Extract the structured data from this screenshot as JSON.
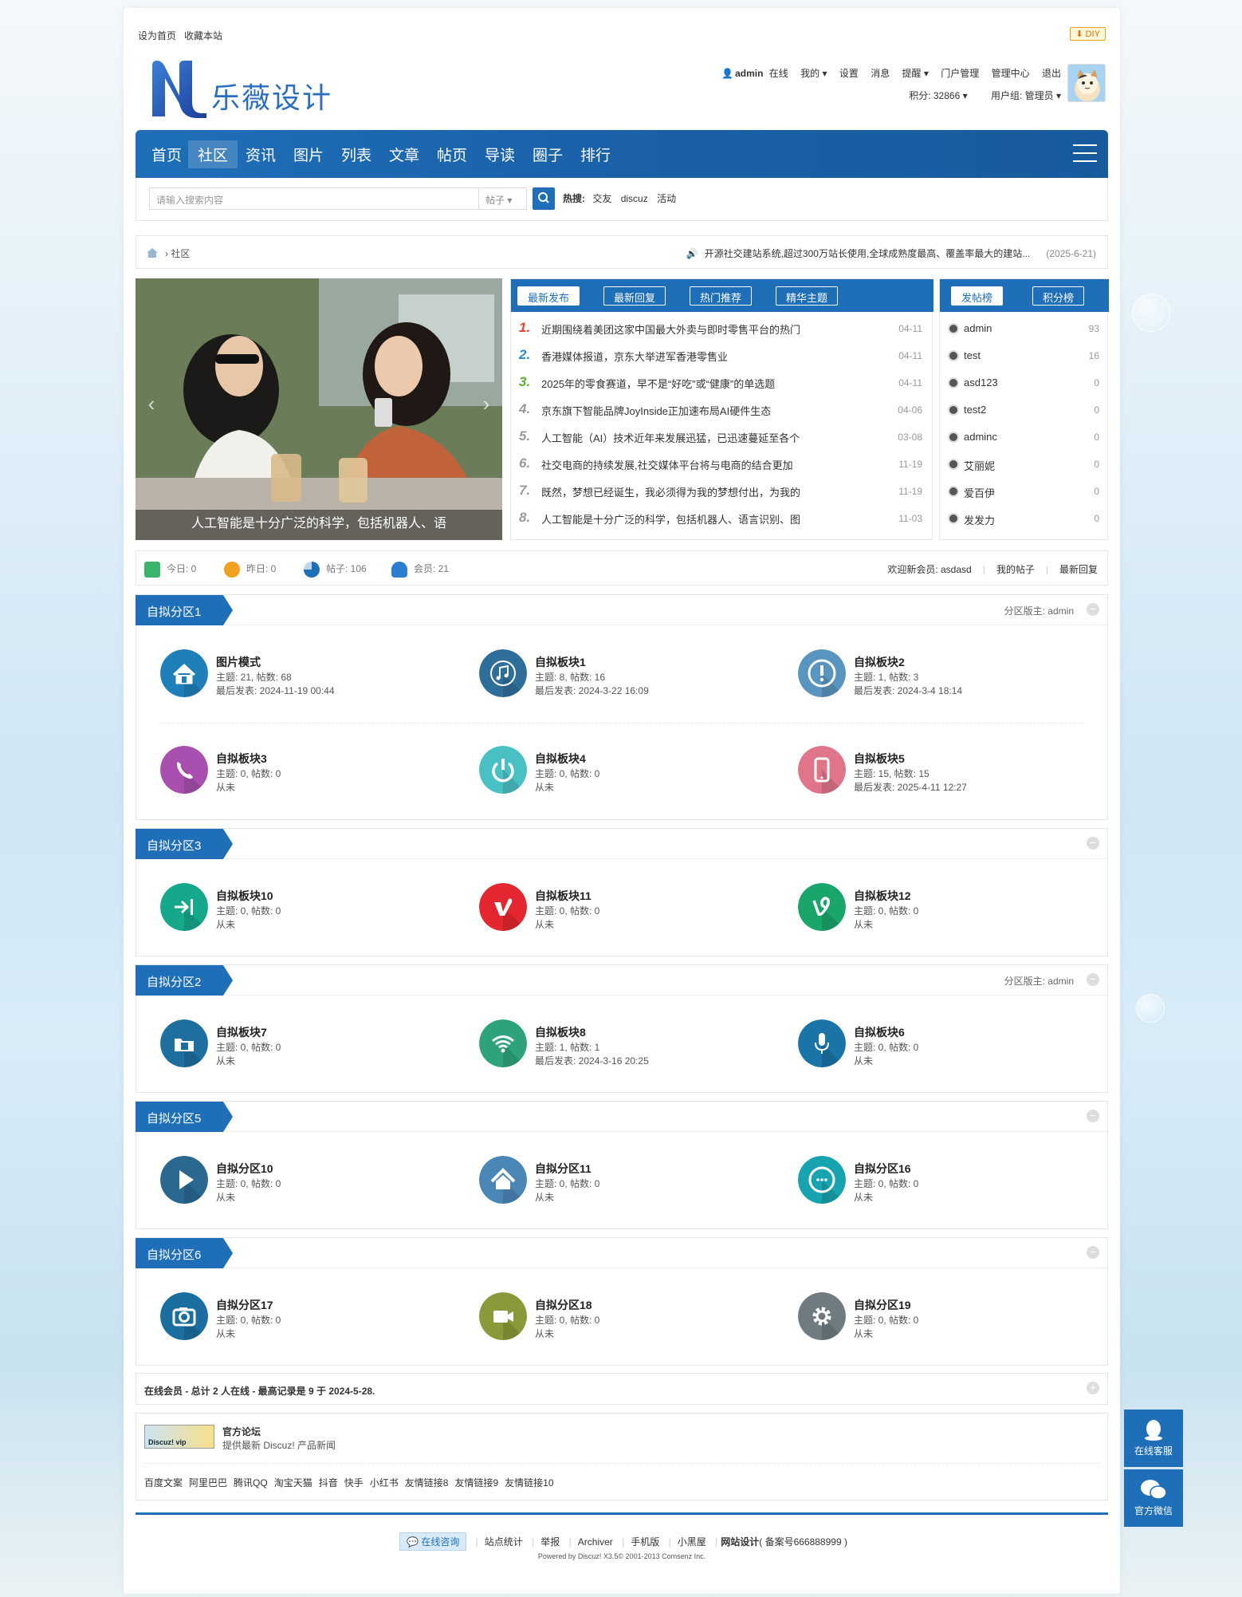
{
  "top": {
    "set_home": "设为首页",
    "bookmark": "收藏本站",
    "diy": "DIY"
  },
  "logo": {
    "text": "乐薇设计"
  },
  "user": {
    "name": "admin",
    "status": "在线",
    "my": "我的",
    "settings": "设置",
    "messages": "消息",
    "remind": "提醒",
    "portal": "门户管理",
    "admin_center": "管理中心",
    "logout": "退出",
    "points": "积分: 32866",
    "group": "用户组: 管理员"
  },
  "nav": {
    "items": [
      "首页",
      "社区",
      "资讯",
      "图片",
      "列表",
      "文章",
      "帖页",
      "导读",
      "圈子",
      "排行"
    ],
    "active": "社区"
  },
  "search": {
    "placeholder": "请输入搜索内容",
    "type": "帖子",
    "hot_label": "热搜:",
    "hot": [
      "交友",
      "discuz",
      "活动"
    ]
  },
  "breadcrumb": {
    "current": "社区"
  },
  "notice": {
    "text": "开源社交建站系统,超过300万站长使用,全球成熟度最高、覆盖率最大的建站...",
    "date": "(2025-6-21)"
  },
  "slide": {
    "caption": "人工智能是十分广泛的科学，包括机器人、语"
  },
  "tabs": [
    "最新发布",
    "最新回复",
    "热门推荐",
    "精华主题"
  ],
  "threads": [
    {
      "n": "1.",
      "t": "近期围绕着美团这家中国最大外卖与即时零售平台的热门",
      "d": "04-11"
    },
    {
      "n": "2.",
      "t": "香港媒体报道，京东大举进军香港零售业",
      "d": "04-11"
    },
    {
      "n": "3.",
      "t": "2025年的零食赛道，早不是“好吃”或“健康”的单选题",
      "d": "04-11"
    },
    {
      "n": "4.",
      "t": "京东旗下智能品牌JoyInside正加速布局AI硬件生态",
      "d": "04-06"
    },
    {
      "n": "5.",
      "t": "人工智能（AI）技术近年来发展迅猛，已迅速蔓延至各个",
      "d": "03-08"
    },
    {
      "n": "6.",
      "t": "社交电商的持续发展,社交媒体平台将与电商的结合更加",
      "d": "11-19"
    },
    {
      "n": "7.",
      "t": "既然，梦想已经诞生，我必须得为我的梦想付出，为我的",
      "d": "11-19"
    },
    {
      "n": "8.",
      "t": "人工智能是十分广泛的科学，包括机器人、语言识别、图",
      "d": "11-03"
    }
  ],
  "rank_tabs": [
    "发帖榜",
    "积分榜"
  ],
  "ranks": [
    {
      "name": "admin",
      "v": "93"
    },
    {
      "name": "test",
      "v": "16"
    },
    {
      "name": "asd123",
      "v": "0"
    },
    {
      "name": "test2",
      "v": "0"
    },
    {
      "name": "adminc",
      "v": "0"
    },
    {
      "name": "艾丽妮",
      "v": "0"
    },
    {
      "name": "爱百伊",
      "v": "0"
    },
    {
      "name": "发发力",
      "v": "0"
    }
  ],
  "stats": {
    "today": "今日: 0",
    "yesterday": "昨日: 0",
    "posts": "帖子: 106",
    "members": "会员: 21",
    "welcome": "欢迎新会员: asdasd",
    "my_posts": "我的帖子",
    "latest_reply": "最新回复"
  },
  "sections": [
    {
      "title": "自拟分区1",
      "mod": "分区版主: admin",
      "forums": [
        {
          "name": "图片模式",
          "s1": "主题: 21, 帖数: 68",
          "s2": "最后发表: 2024-11-19 00:44",
          "icon": "home-icon",
          "color": "#1f7fb8"
        },
        {
          "name": "自拟板块1",
          "s1": "主题: 8, 帖数: 16",
          "s2": "最后发表: 2024-3-22 16:09",
          "icon": "music-icon",
          "color": "#2f6e98"
        },
        {
          "name": "自拟板块2",
          "s1": "主题: 1, 帖数: 3",
          "s2": "最后发表: 2024-3-4 18:14",
          "icon": "alert-icon",
          "color": "#5a95bf"
        },
        {
          "name": "自拟板块3",
          "s1": "主题: 0, 帖数: 0",
          "s2": "从未",
          "icon": "phone-icon",
          "color": "#a94fb0"
        },
        {
          "name": "自拟板块4",
          "s1": "主题: 0, 帖数: 0",
          "s2": "从未",
          "icon": "power-icon",
          "color": "#49c0c4"
        },
        {
          "name": "自拟板块5",
          "s1": "主题: 15, 帖数: 15",
          "s2": "最后发表: 2025-4-11 12:27",
          "icon": "mobile-icon",
          "color": "#e0758a"
        }
      ]
    },
    {
      "title": "自拟分区3",
      "mod": "",
      "forums": [
        {
          "name": "自拟板块10",
          "s1": "主题: 0, 帖数: 0",
          "s2": "从未",
          "icon": "login-icon",
          "color": "#16a88a"
        },
        {
          "name": "自拟板块11",
          "s1": "主题: 0, 帖数: 0",
          "s2": "从未",
          "icon": "vimeo-icon",
          "color": "#e3262f"
        },
        {
          "name": "自拟板块12",
          "s1": "主题: 0, 帖数: 0",
          "s2": "从未",
          "icon": "vine-icon",
          "color": "#1aa56a"
        }
      ]
    },
    {
      "title": "自拟分区2",
      "mod": "分区版主: admin",
      "forums": [
        {
          "name": "自拟板块7",
          "s1": "主题: 0, 帖数: 0",
          "s2": "从未",
          "icon": "folder-icon",
          "color": "#1e6ea0"
        },
        {
          "name": "自拟板块8",
          "s1": "主题: 1, 帖数: 1",
          "s2": "最后发表: 2024-3-16 20:25",
          "icon": "wifi-icon",
          "color": "#2ea37a"
        },
        {
          "name": "自拟板块6",
          "s1": "主题: 0, 帖数: 0",
          "s2": "从未",
          "icon": "mic-icon",
          "color": "#1a74a8"
        }
      ]
    },
    {
      "title": "自拟分区5",
      "mod": "",
      "forums": [
        {
          "name": "自拟分区10",
          "s1": "主题: 0, 帖数: 0",
          "s2": "从未",
          "icon": "play-icon",
          "color": "#2a6890"
        },
        {
          "name": "自拟分区11",
          "s1": "主题: 0, 帖数: 0",
          "s2": "从未",
          "icon": "house-icon",
          "color": "#4a86b6"
        },
        {
          "name": "自拟分区16",
          "s1": "主题: 0, 帖数: 0",
          "s2": "从未",
          "icon": "chat-icon",
          "color": "#17a3b0"
        }
      ]
    },
    {
      "title": "自拟分区6",
      "mod": "",
      "forums": [
        {
          "name": "自拟分区17",
          "s1": "主题: 0, 帖数: 0",
          "s2": "从未",
          "icon": "camera-icon",
          "color": "#1a6fa0"
        },
        {
          "name": "自拟分区18",
          "s1": "主题: 0, 帖数: 0",
          "s2": "从未",
          "icon": "video-icon",
          "color": "#8a9a3a"
        },
        {
          "name": "自拟分区19",
          "s1": "主题: 0, 帖数: 0",
          "s2": "从未",
          "icon": "gear-icon",
          "color": "#6f7b80"
        }
      ]
    }
  ],
  "online": {
    "text": "在线会员 - 总计 2 人在线 - 最高记录是 9 于 2024-5-28."
  },
  "friend": {
    "logo_text": "Discuz! vip",
    "title": "官方论坛",
    "desc": "提供最新 Discuz! 产品新闻",
    "links": [
      "百度文案",
      "阿里巴巴",
      "腾讯QQ",
      "淘宝天猫",
      "抖音",
      "快手",
      "小红书",
      "友情链接8",
      "友情链接9",
      "友情链接10"
    ]
  },
  "footer": {
    "consult": "在线咨询",
    "items": [
      "站点统计",
      "举报",
      "Archiver",
      "手机版",
      "小黑屋"
    ],
    "brand": "网站设计",
    "icp": "( 备案号666888999 )",
    "powered": "Powered by Discuz! X3.5© 2001-2013 Comsenz Inc."
  },
  "float": {
    "service": "在线客服",
    "wechat": "官方微信"
  }
}
